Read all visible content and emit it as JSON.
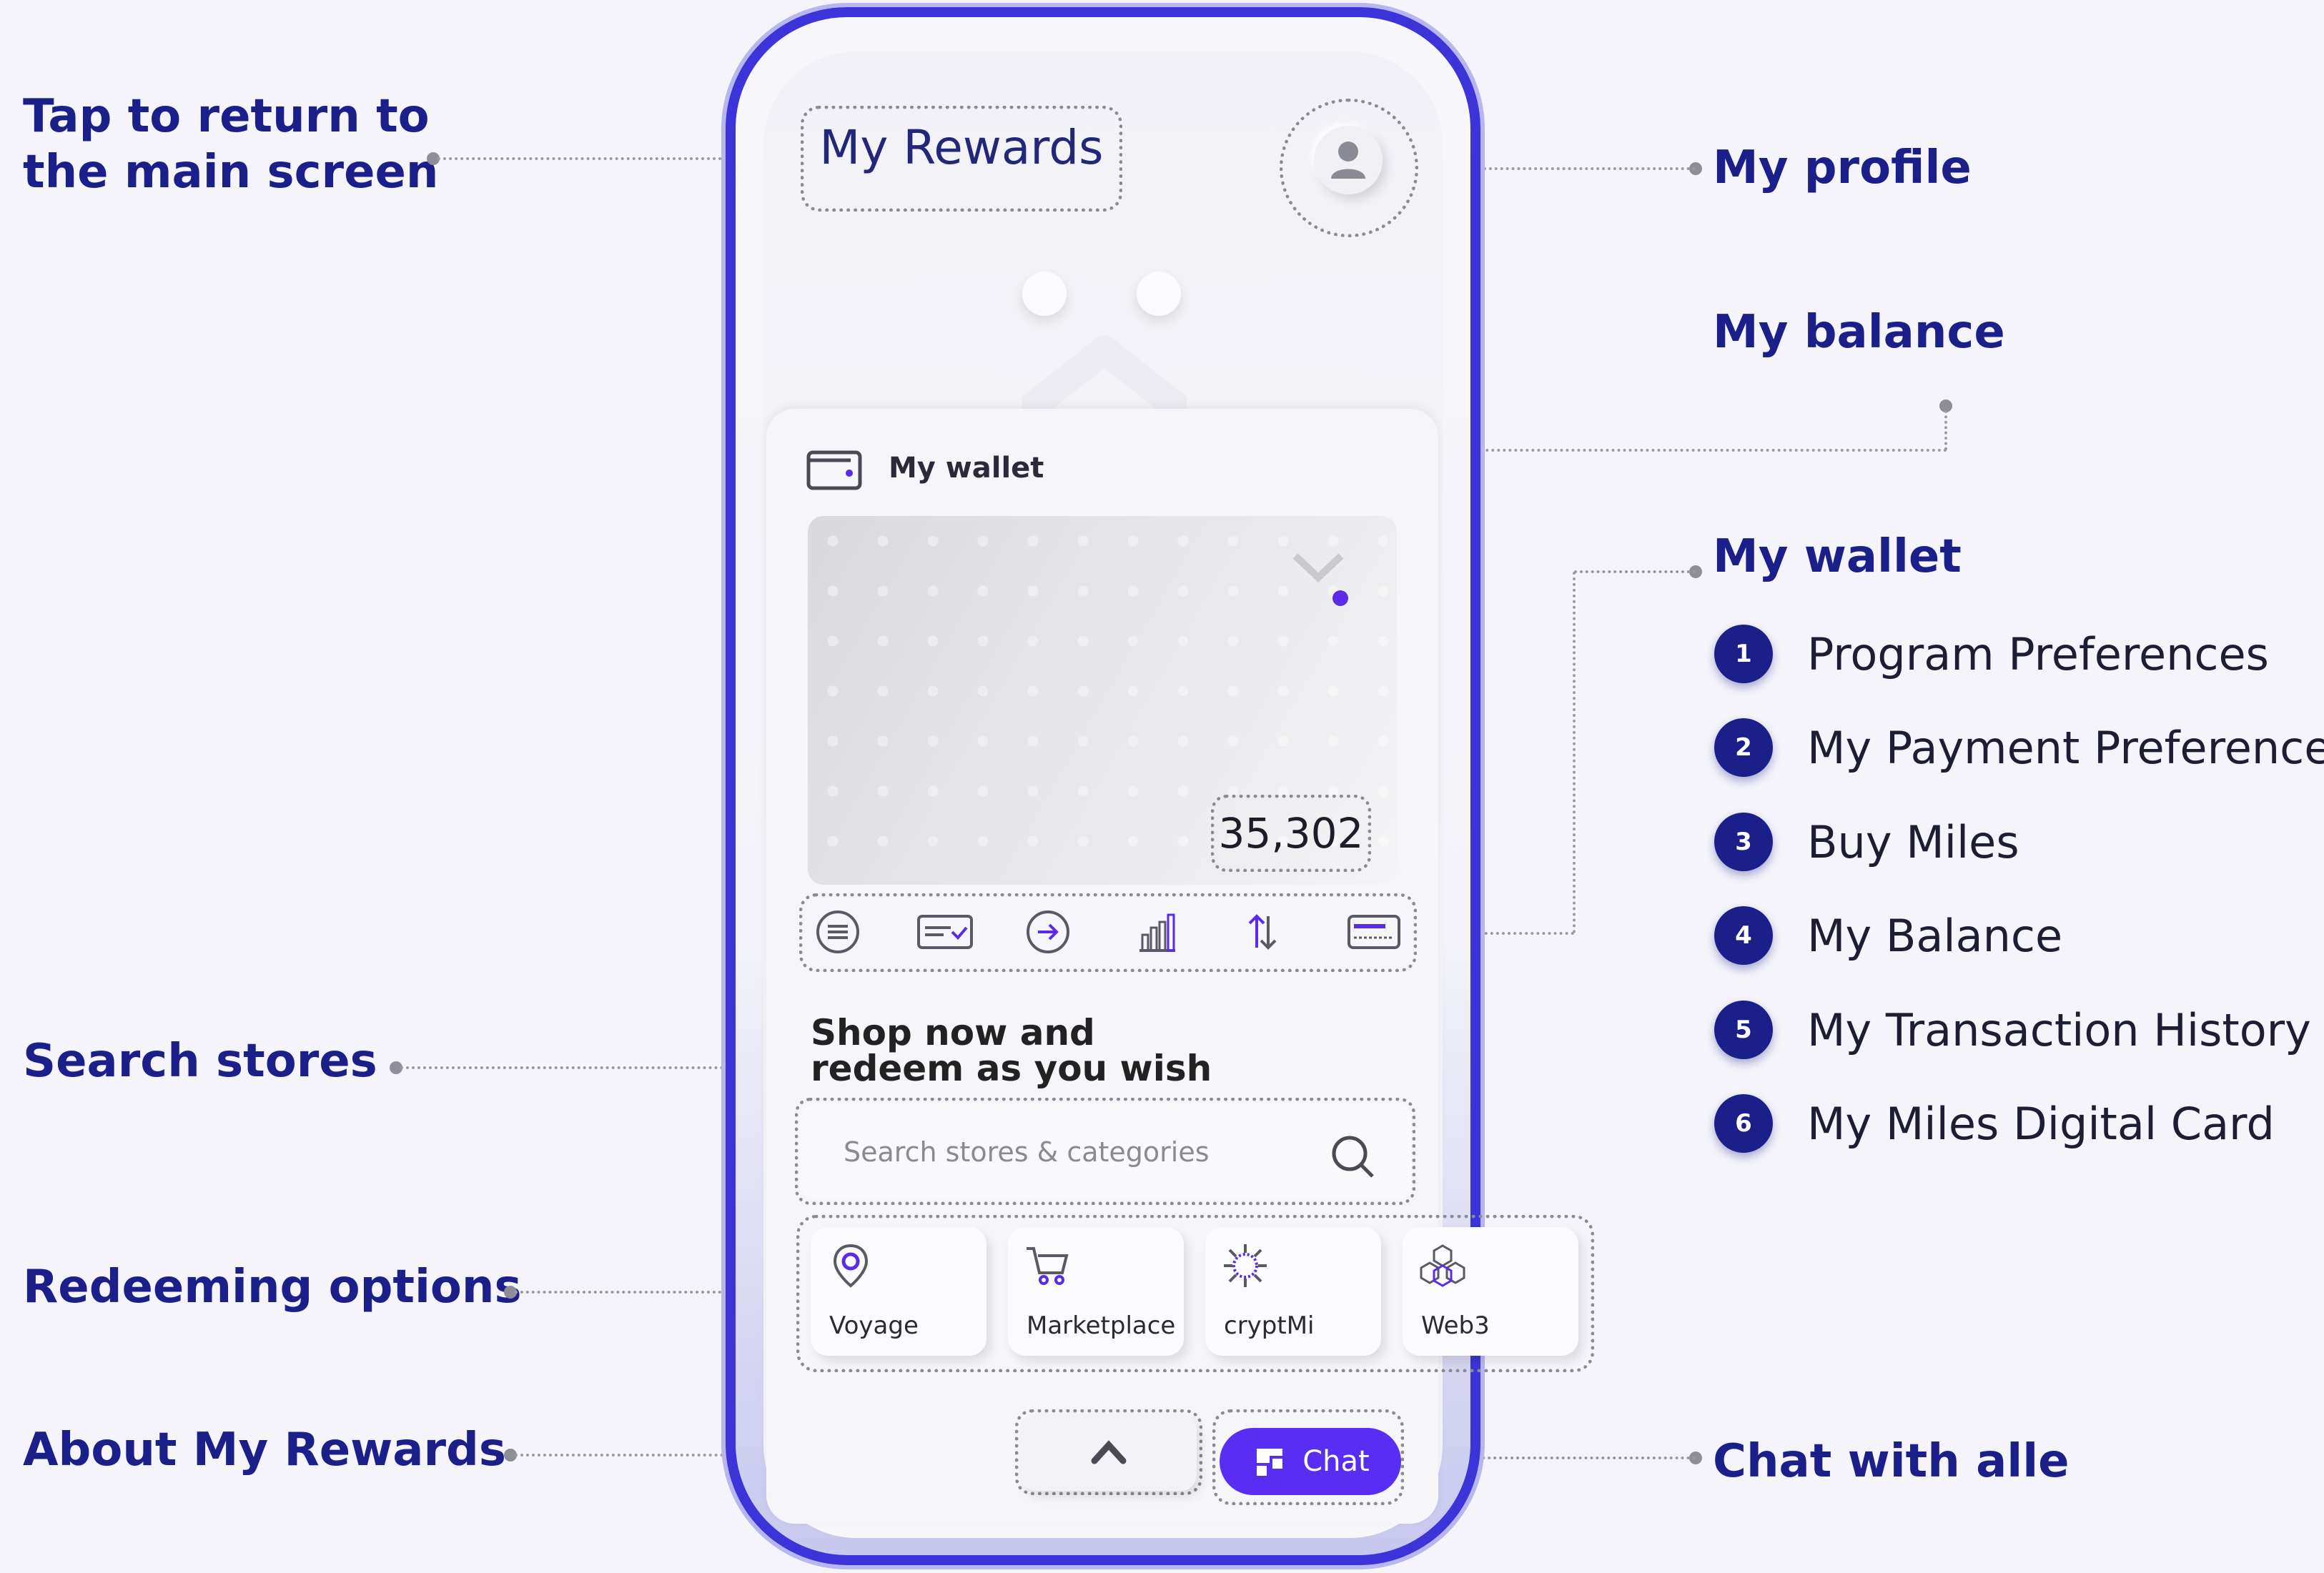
{
  "callouts": {
    "main_screen_line1": "Tap to return to",
    "main_screen_line2": "the main screen",
    "my_profile": "My profile",
    "my_balance": "My balance",
    "my_wallet": "My wallet",
    "search_stores": "Search stores",
    "redeeming_options": "Redeeming options",
    "about_my_rewards": "About My Rewards",
    "chat_with_alle": "Chat with alle"
  },
  "wallet_features": [
    {
      "num": "1",
      "label": "Program Preferences"
    },
    {
      "num": "2",
      "label": "My Payment Preferences"
    },
    {
      "num": "3",
      "label": "Buy Miles"
    },
    {
      "num": "4",
      "label": "My Balance"
    },
    {
      "num": "5",
      "label": "My Transaction History"
    },
    {
      "num": "6",
      "label": "My Miles Digital Card"
    }
  ],
  "app": {
    "title": "My Rewards",
    "wallet_label": "My wallet",
    "balance": "35,302",
    "shop_line1": "Shop now and",
    "shop_line2": "redeem as you wish",
    "search_placeholder": "Search stores & categories",
    "options": [
      "Voyage",
      "Marketplace",
      "cryptMi",
      "Web3"
    ],
    "chat_label": "Chat"
  },
  "wallet_action_icons": [
    "menu-icon",
    "card-check-icon",
    "arrow-right-circle-icon",
    "bar-chart-icon",
    "transfer-icon",
    "digital-card-icon"
  ],
  "colors": {
    "accent": "#3c34d8",
    "callout_text": "#1b1f8a",
    "chat_button": "#5a2ef2",
    "wallet_dot": "#5b2be6"
  }
}
